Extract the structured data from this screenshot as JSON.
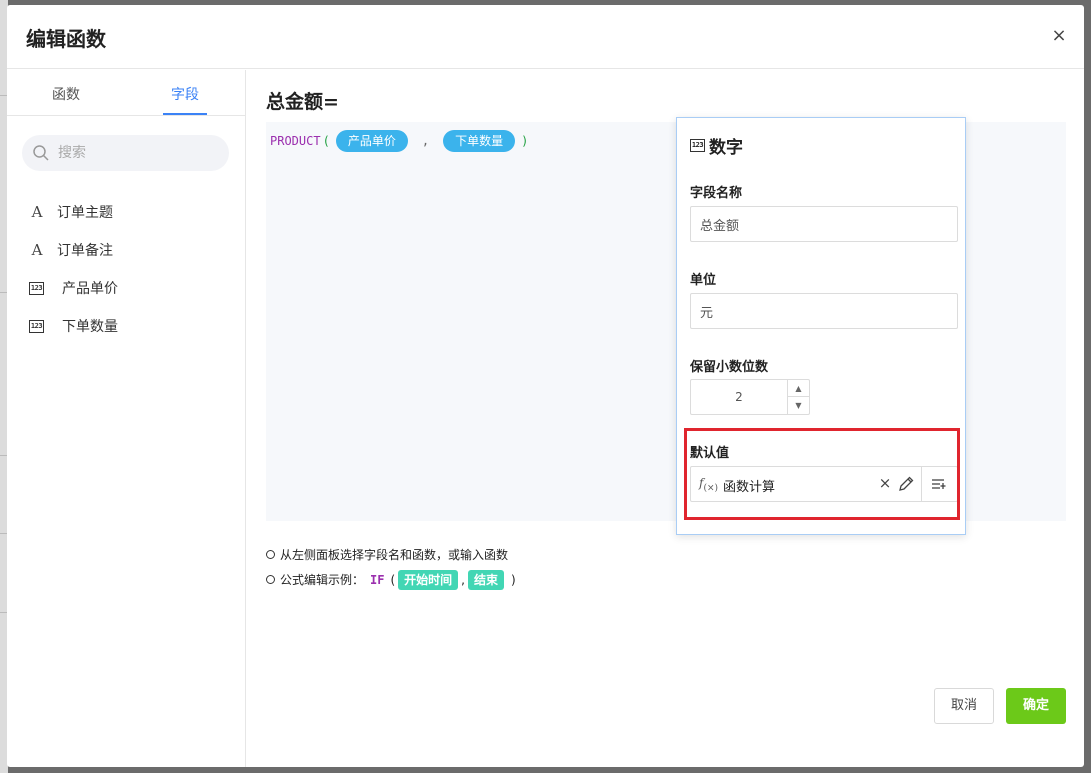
{
  "dialog": {
    "title": "编辑函数",
    "close_label": "×"
  },
  "left": {
    "tabs": [
      {
        "label": "函数",
        "active": false
      },
      {
        "label": "字段",
        "active": true
      }
    ],
    "search_placeholder": "搜索",
    "fields": [
      {
        "label": "订单主题",
        "type": "text",
        "icon": "text-icon"
      },
      {
        "label": "订单备注",
        "type": "text",
        "icon": "text-icon"
      },
      {
        "label": "产品单价",
        "type": "number",
        "icon": "number-icon"
      },
      {
        "label": "下单数量",
        "type": "number",
        "icon": "number-icon"
      }
    ],
    "text_icon_glyph": "A",
    "number_icon_glyph": "123"
  },
  "formula": {
    "title": "总金额=",
    "function_name": "PRODUCT",
    "open_paren": "(",
    "close_paren": ")",
    "separator": ",",
    "args": [
      "产品单价",
      "下单数量"
    ]
  },
  "hints": {
    "line1": "从左侧面板选择字段名和函数，或输入函数",
    "line2_prefix": "公式编辑示例：",
    "line2_func": "IF",
    "line2_open": "(",
    "line2_arg1": "开始时间",
    "line2_sep": ",",
    "line2_arg2": "结束",
    "line2_close": ")"
  },
  "buttons": {
    "cancel": "取消",
    "confirm": "确定"
  },
  "popover": {
    "title": "数字",
    "field_name_label": "字段名称",
    "field_name_value": "总金额",
    "unit_label": "单位",
    "unit_value": "元",
    "decimals_label": "保留小数位数",
    "decimals_value": "2",
    "default_label": "默认值",
    "default_value": "函数计算",
    "fx_symbol": "f",
    "fx_sub": "(×)",
    "clear_symbol": "×"
  },
  "colors": {
    "accent": "#3b82f6",
    "chip_blue": "#3bb3ec",
    "chip_green": "#42d6b4",
    "confirm_green": "#6cc919",
    "highlight_red": "#e0252e"
  }
}
